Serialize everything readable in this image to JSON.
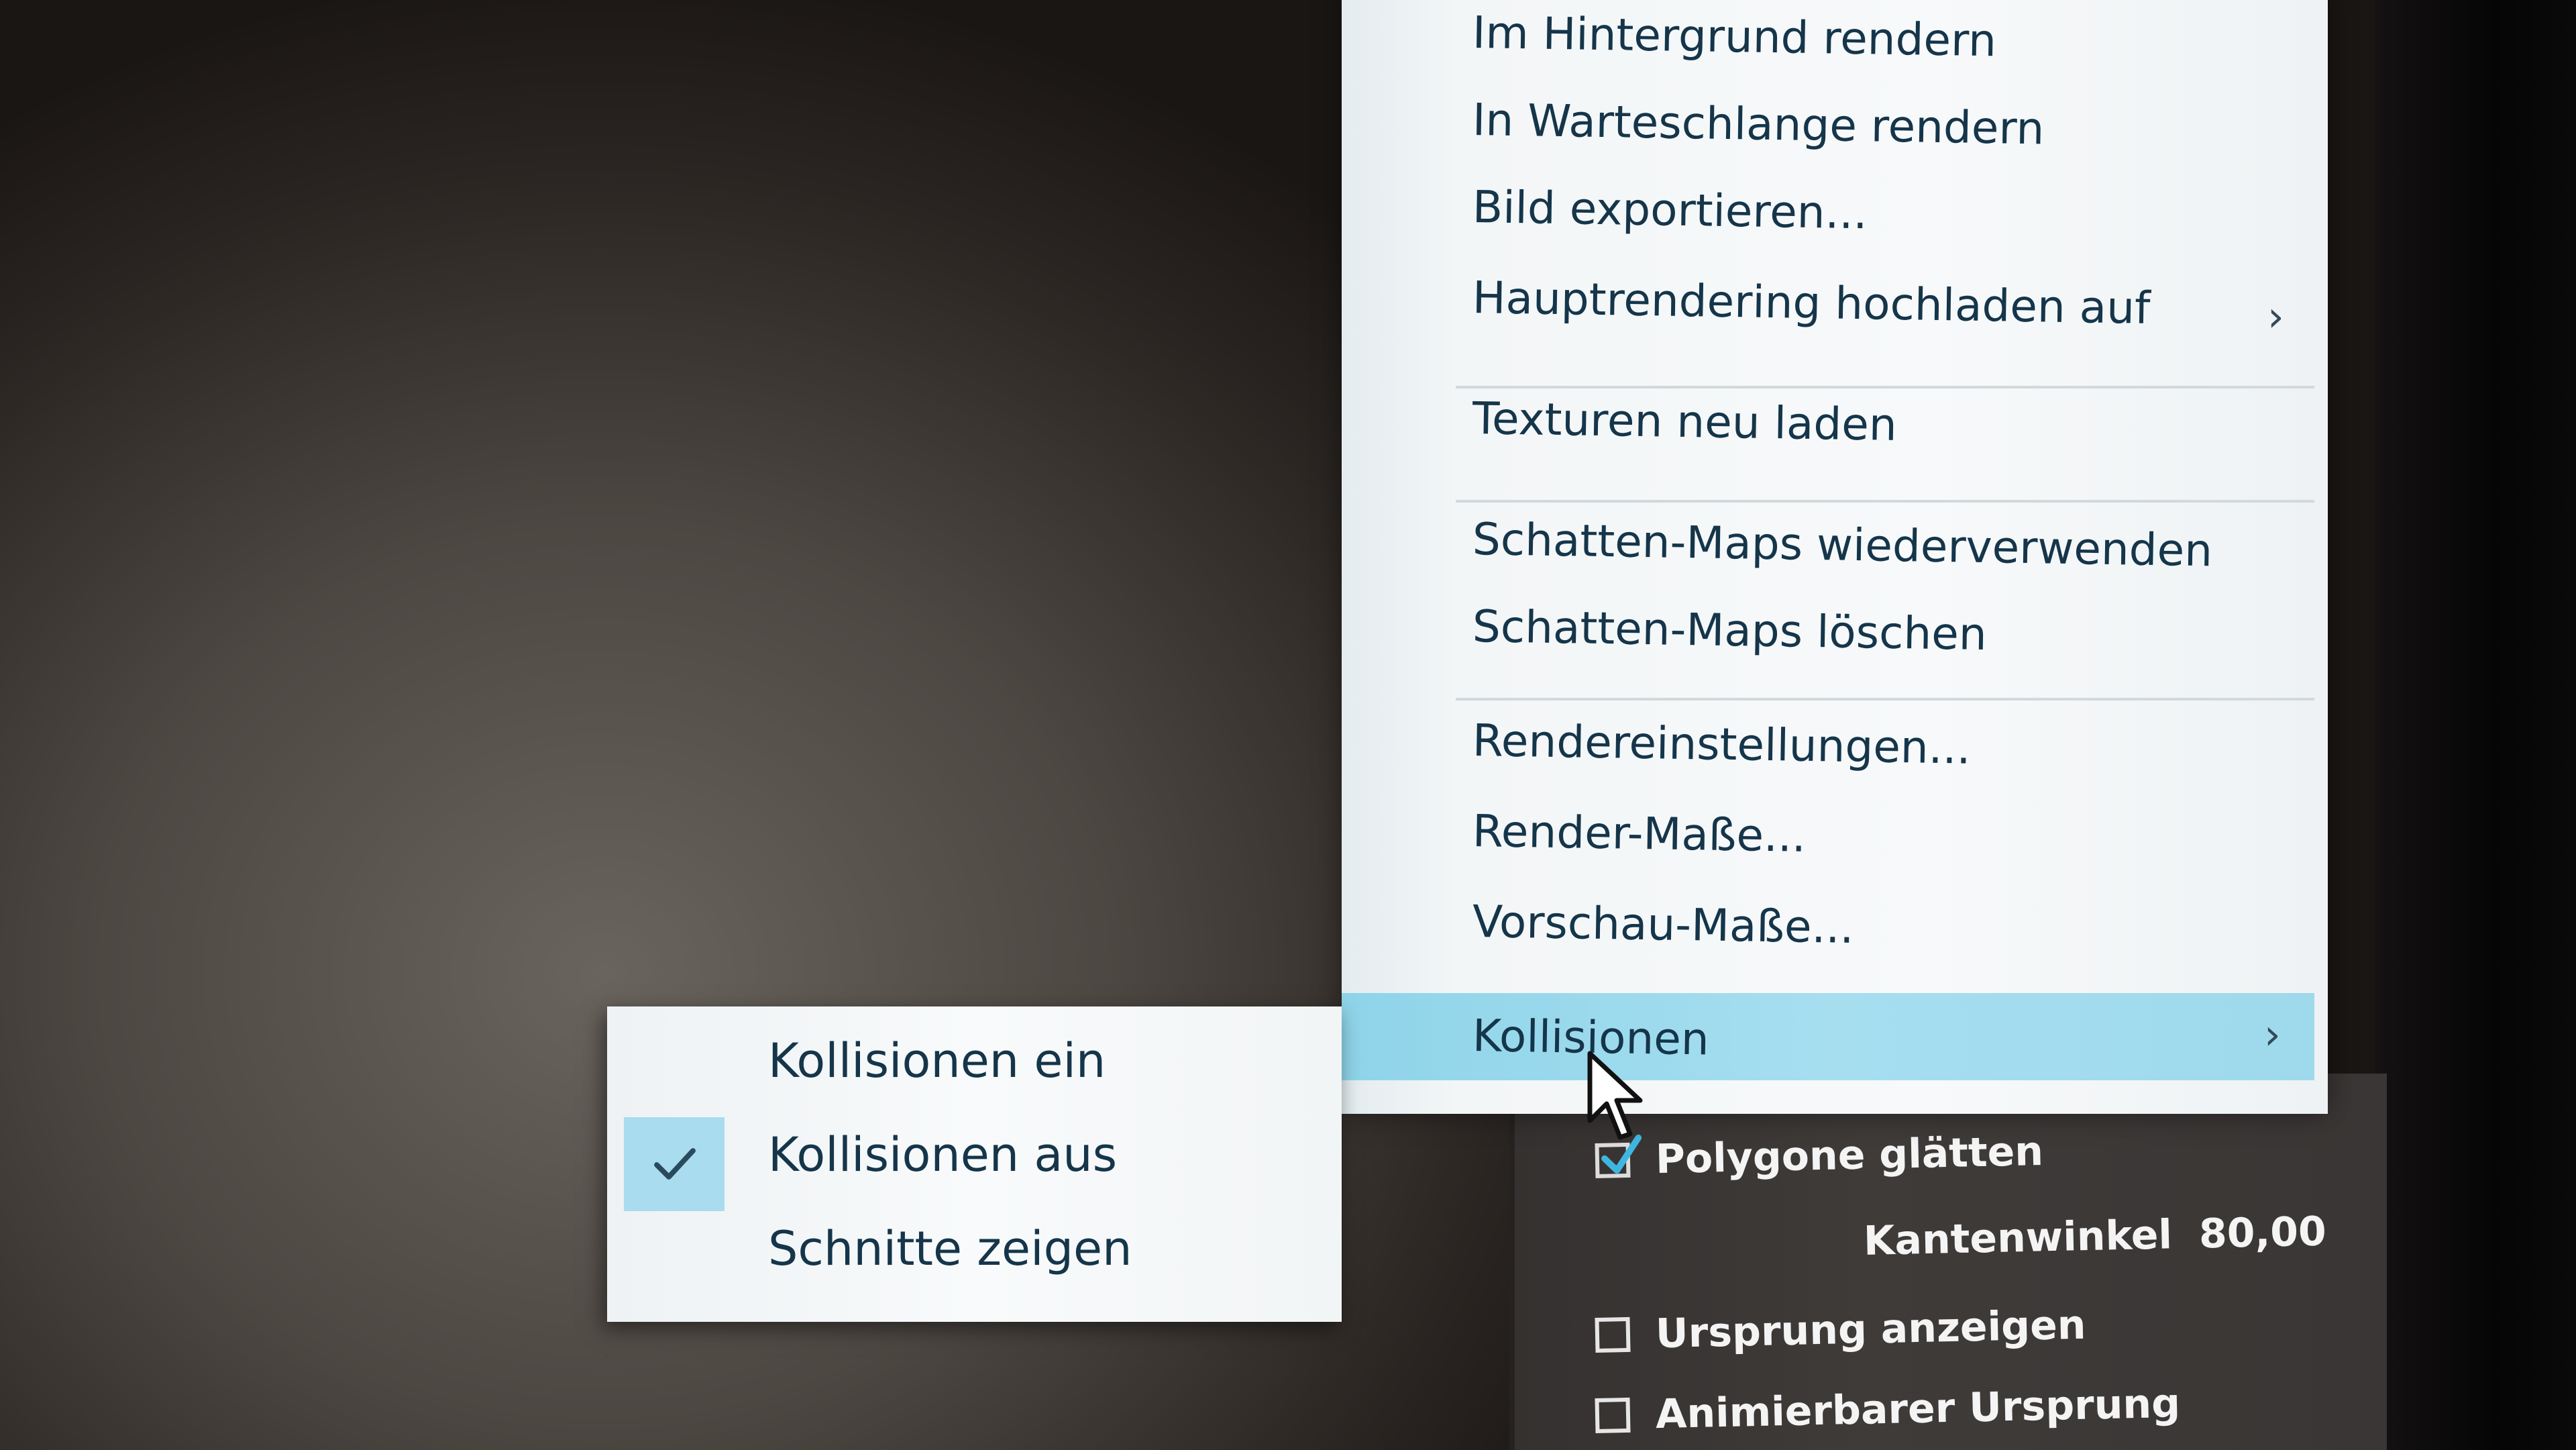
{
  "main_menu": {
    "items": [
      {
        "label": "Im Hintergrund rendern"
      },
      {
        "label": "In Warteschlange rendern"
      },
      {
        "label": "Bild exportieren..."
      },
      {
        "label": "Hauptrendering hochladen auf",
        "submenu_icon": "chevron-right-icon"
      },
      {
        "label": "Texturen neu laden"
      },
      {
        "label": "Schatten-Maps wiederverwenden"
      },
      {
        "label": "Schatten-Maps löschen"
      },
      {
        "label": "Rendereinstellungen..."
      },
      {
        "label": "Render-Maße..."
      },
      {
        "label": "Vorschau-Maße..."
      },
      {
        "label": "Kollisionen",
        "submenu_icon": "chevron-right-icon",
        "highlighted": true
      }
    ],
    "arrow_glyph": "›"
  },
  "collision_submenu": {
    "items": [
      {
        "label": "Kollisionen ein",
        "checked": false
      },
      {
        "label": "Kollisionen aus",
        "checked": true
      },
      {
        "label": "Schnitte zeigen",
        "checked": false
      }
    ]
  },
  "properties": {
    "smooth_polygons": {
      "label": "Polygone glätten",
      "checked": true
    },
    "edge_angle": {
      "label": "Kantenwinkel",
      "value": "80,00"
    },
    "show_origin": {
      "label": "Ursprung anzeigen",
      "checked": false
    },
    "animatable_origin": {
      "label": "Animierbarer Ursprung",
      "checked": false
    }
  },
  "colors": {
    "menu_text": "#15354a",
    "highlight": "#9ed9ec",
    "panel_bg": "#3a3635"
  }
}
